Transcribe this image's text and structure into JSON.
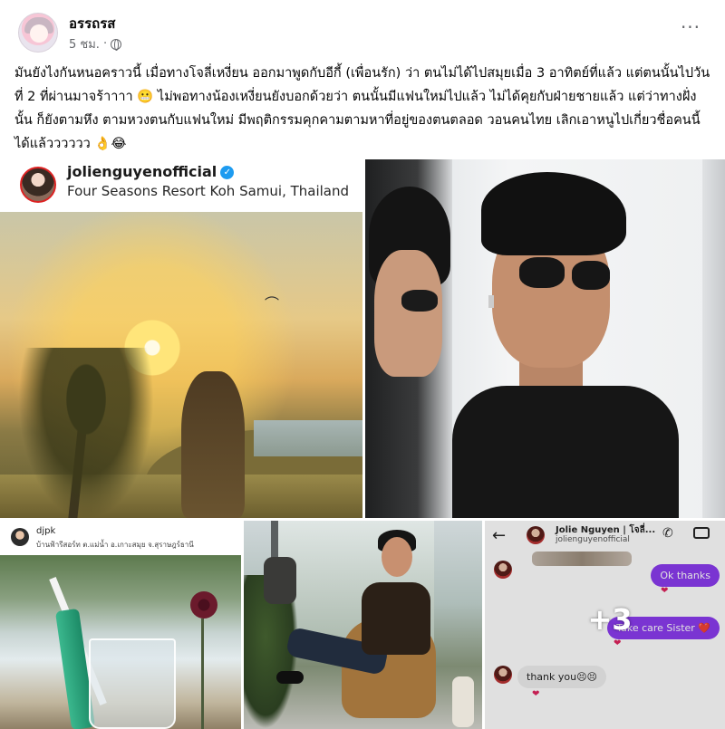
{
  "post": {
    "author": "อรรถรส",
    "time": "5 ชม.",
    "separator": "·",
    "more_label": "···",
    "text": "มันยังไงกันหนอคราวนี้ เมื่อทางโจลี่เหงี่ยน ออกมาพูดกับอีกี้ (เพื่อนรัก) ว่า ตนไม่ได้ไปสมุยเมื่อ 3 อาทิตย์ที่แล้ว แต่ตนนั้นไปวันที่ 2 ที่ผ่านมาจร้าาาา 😬  ไม่พอทางน้องเหงี่ยนยังบอกด้วยว่า ตนนั้นมีแฟนใหม่ไปแล้ว ไม่ได้คุยกับฝ่ายชายแล้ว แต่ว่าทางฝั่งนั้น ก็ยังตามหึง ตามหวงตนกับแฟนใหม่  มีพฤติกรรมคุกคามตามหาที่อยู่ของตนตลอด วอนคนไทย เลิกเอาหนูไปเกี่ยวชื่อคนนี้ได้แล้วววววว 👌😂"
  },
  "photos": {
    "ig_post": {
      "username": "jolienguyenofficial",
      "location": "Four Seasons Resort Koh Samui, Thailand",
      "verified_mark": "✓"
    },
    "story": {
      "username": "djpk",
      "location": "บ้านฟ้ารีสอร์ท ต.แม่น้ำ อ.เกาะสมุย จ.สุราษฎร์ธานี"
    },
    "dm": {
      "back": "←",
      "name": "Jolie Nguyen | โจลี่...",
      "handle": "jolienguyenofficial",
      "call_icon": "✆",
      "messages": [
        {
          "text": "Ok thanks",
          "from": "me"
        },
        {
          "text": "Take care Sister ❤️",
          "from": "me"
        },
        {
          "text": "thank you😣😣",
          "from": "them"
        }
      ],
      "heart": "❤"
    },
    "more_count": "+3"
  },
  "colors": {
    "meta_gray": "#65676b",
    "messenger_purple": "#8b3cf0",
    "verified_blue": "#1d9bf0"
  }
}
